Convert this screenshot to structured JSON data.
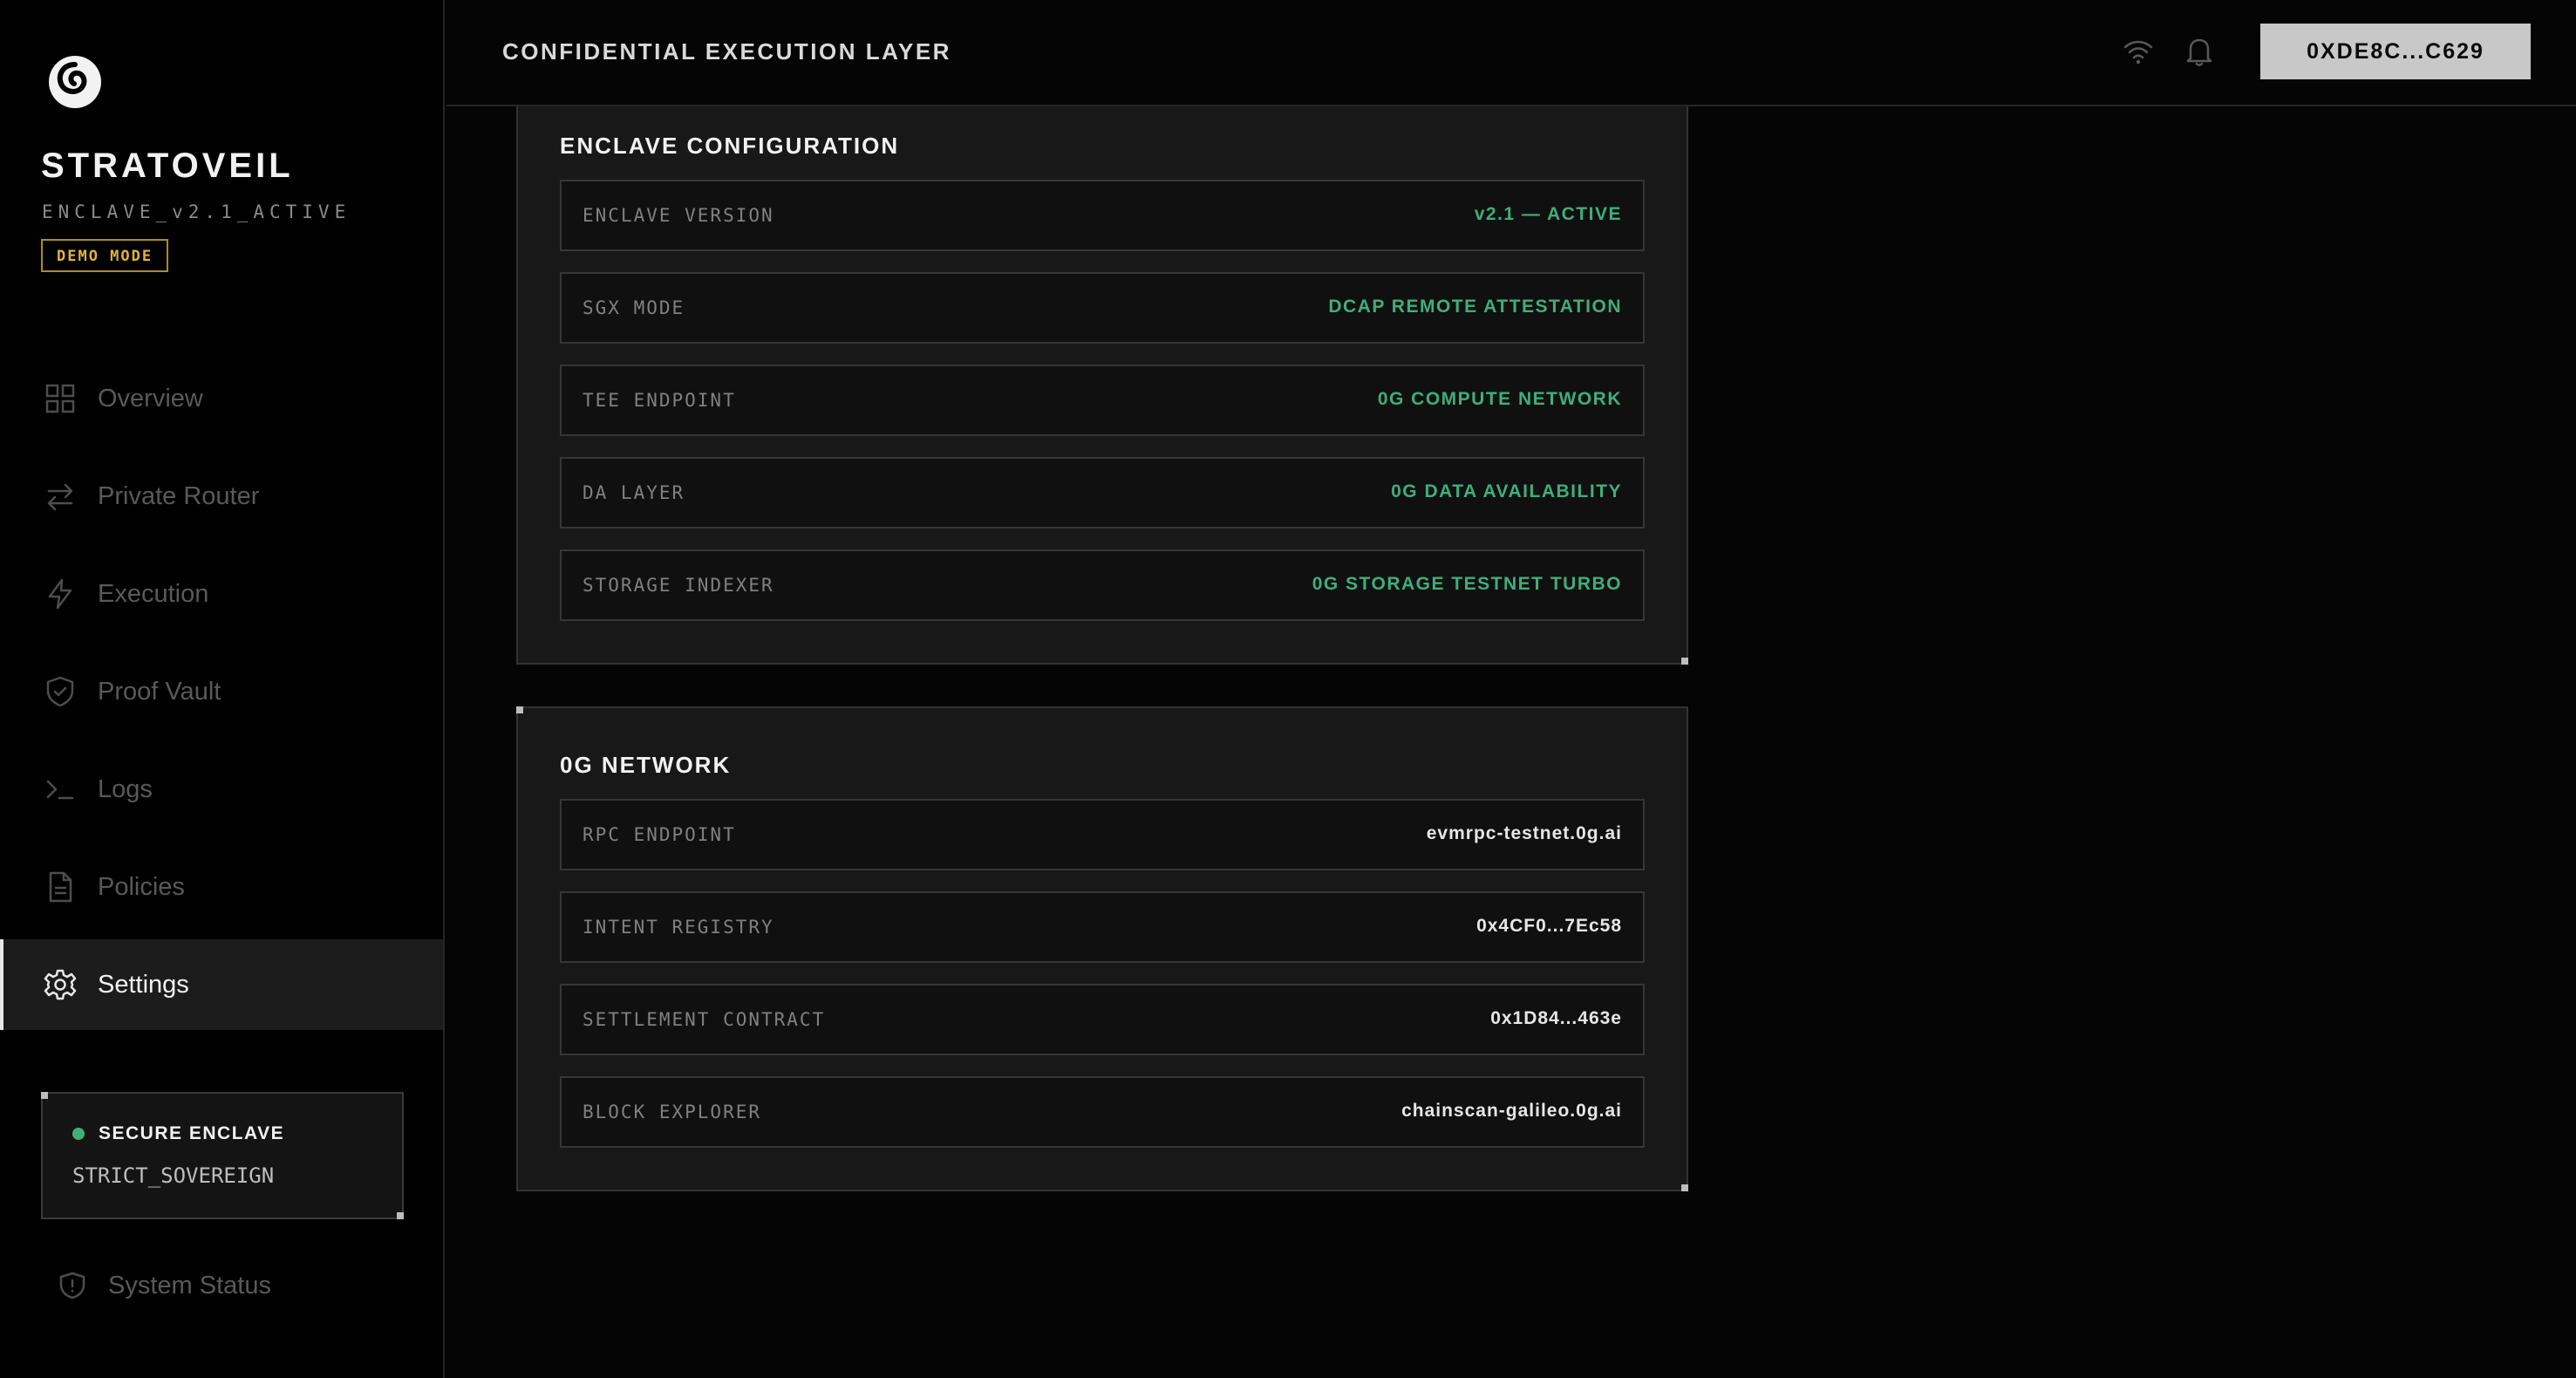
{
  "brand": {
    "name": "STRATOVEIL",
    "subtitle": "ENCLAVE_v2.1_ACTIVE",
    "badge": "DEMO MODE"
  },
  "nav": {
    "items": [
      {
        "label": "Overview",
        "icon": "grid-icon",
        "active": false
      },
      {
        "label": "Private Router",
        "icon": "arrows-swap-icon",
        "active": false
      },
      {
        "label": "Execution",
        "icon": "lightning-icon",
        "active": false
      },
      {
        "label": "Proof Vault",
        "icon": "shield-check-icon",
        "active": false
      },
      {
        "label": "Logs",
        "icon": "terminal-icon",
        "active": false
      },
      {
        "label": "Policies",
        "icon": "document-icon",
        "active": false
      },
      {
        "label": "Settings",
        "icon": "gear-icon",
        "active": true
      }
    ]
  },
  "secure_card": {
    "title": "SECURE ENCLAVE",
    "value": "STRICT_SOVEREIGN"
  },
  "system_status": {
    "label": "System Status"
  },
  "header": {
    "title": "CONFIDENTIAL EXECUTION LAYER",
    "wallet": "0XDE8C...C629"
  },
  "enclave_config": {
    "title": "ENCLAVE CONFIGURATION",
    "rows": [
      {
        "label": "ENCLAVE VERSION",
        "value": "v2.1 — ACTIVE"
      },
      {
        "label": "SGX MODE",
        "value": "DCAP REMOTE ATTESTATION"
      },
      {
        "label": "TEE ENDPOINT",
        "value": "0G COMPUTE NETWORK"
      },
      {
        "label": "DA LAYER",
        "value": "0G DATA AVAILABILITY"
      },
      {
        "label": "STORAGE INDEXER",
        "value": "0G STORAGE TESTNET TURBO"
      }
    ]
  },
  "network": {
    "title": "0G NETWORK",
    "rows": [
      {
        "label": "RPC ENDPOINT",
        "value": "evmrpc-testnet.0g.ai"
      },
      {
        "label": "INTENT REGISTRY",
        "value": "0x4CF0...7Ec58"
      },
      {
        "label": "SETTLEMENT CONTRACT",
        "value": "0x1D84...463e"
      },
      {
        "label": "BLOCK EXPLORER",
        "value": "chainscan-galileo.0g.ai"
      }
    ]
  },
  "colors": {
    "accent_green": "#3fae7c",
    "demo_amber": "#e4b43a"
  }
}
